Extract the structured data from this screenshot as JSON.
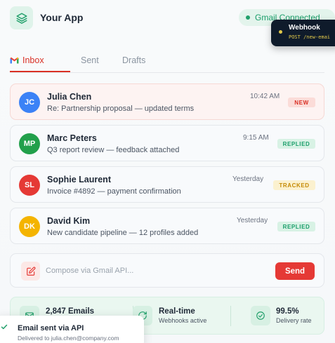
{
  "app": {
    "title": "Your App"
  },
  "status": {
    "label": "Gmail Connected",
    "color": "#22a06b"
  },
  "webhook": {
    "title": "Webhook",
    "endpoint": "POST /new-emai"
  },
  "tabs": [
    {
      "label": "Inbox",
      "active": true,
      "icon": "gmail-icon"
    },
    {
      "label": "Sent",
      "active": false
    },
    {
      "label": "Drafts",
      "active": false
    }
  ],
  "emails": [
    {
      "initials": "JC",
      "sender": "Julia Chen",
      "subject": "Re: Partnership proposal — updated terms",
      "time": "10:42 AM",
      "badge": "NEW",
      "avatar_color": "#3b82f6",
      "unread": true
    },
    {
      "initials": "MP",
      "sender": "Marc Peters",
      "subject": "Q3 report review — feedback attached",
      "time": "9:15 AM",
      "badge": "REPLIED",
      "avatar_color": "#22a04b",
      "unread": false
    },
    {
      "initials": "SL",
      "sender": "Sophie Laurent",
      "subject": "Invoice #4892 — payment confirmation",
      "time": "Yesterday",
      "badge": "TRACKED",
      "avatar_color": "#e53935",
      "unread": false
    },
    {
      "initials": "DK",
      "sender": "David Kim",
      "subject": "New candidate pipeline — 12 profiles added",
      "time": "Yesterday",
      "badge": "REPLIED",
      "avatar_color": "#f4b400",
      "unread": false
    }
  ],
  "compose": {
    "placeholder": "Compose via Gmail API...",
    "send_label": "Send"
  },
  "stats": [
    {
      "value": "2,847 Emails",
      "label": "",
      "icon": "mail-icon"
    },
    {
      "value": "Real-time",
      "label": "Webhooks active",
      "icon": "refresh-icon"
    },
    {
      "value": "99.5%",
      "label": "Delivery rate",
      "icon": "check-circle-icon"
    }
  ],
  "toast": {
    "title": "Email sent via API",
    "subtitle": "Delivered to julia.chen@company.com"
  },
  "colors": {
    "accent": "#d93025",
    "success": "#22a06b",
    "badge_new": "#d93025",
    "badge_replied": "#1a9e6a",
    "badge_tracked": "#c58a05"
  }
}
